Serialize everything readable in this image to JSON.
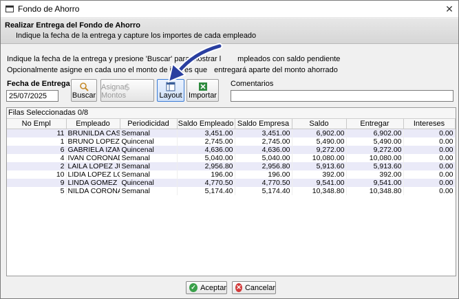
{
  "window": {
    "title": "Fondo de Ahorro",
    "close_glyph": "✕"
  },
  "header": {
    "title": "Realizar Entrega del Fondo de Ahorro",
    "subtitle": "Indique la fecha de la entrega y capture los importes de cada empleado"
  },
  "instructions": {
    "line1_start": "Indique la fecha de la entrega y presione 'Buscar' para mostrar l",
    "line1_end": "mpleados con saldo pendiente",
    "line2_start": "Opcionalmente asigne en cada uno el monto de interés que",
    "line2_end": "entregará aparte del monto ahorrado"
  },
  "form": {
    "date_label": "Fecha de Entrega",
    "date_value": "25/07/2025",
    "comments_label": "Comentarios",
    "comments_value": ""
  },
  "toolbar": {
    "buscar": "Buscar",
    "asignar": "Asignar Montos",
    "layout": "Layout",
    "importar": "Importar"
  },
  "grid": {
    "status": "Filas Seleccionadas  0/8",
    "columns": [
      "No Empl",
      "Empleado",
      "Periodicidad",
      "Saldo Empleado",
      "Saldo Empresa",
      "Saldo",
      "Entregar",
      "Intereses"
    ],
    "rows": [
      [
        "11",
        "BRUNILDA CAST...",
        "Semanal",
        "3,451.00",
        "3,451.00",
        "6,902.00",
        "6,902.00",
        "0.00"
      ],
      [
        "1",
        "BRUNO LOPEZ L...",
        "Quincenal",
        "2,745.00",
        "2,745.00",
        "5,490.00",
        "5,490.00",
        "0.00"
      ],
      [
        "6",
        "GABRIELA IZAM...",
        "Quincenal",
        "4,636.00",
        "4,636.00",
        "9,272.00",
        "9,272.00",
        "0.00"
      ],
      [
        "4",
        "IVAN CORONAD...",
        "Semanal",
        "5,040.00",
        "5,040.00",
        "10,080.00",
        "10,080.00",
        "0.00"
      ],
      [
        "2",
        "LAILA LOPEZ JU...",
        "Semanal",
        "2,956.80",
        "2,956.80",
        "5,913.60",
        "5,913.60",
        "0.00"
      ],
      [
        "10",
        "LIDIA LOPEZ LO...",
        "Semanal",
        "196.00",
        "196.00",
        "392.00",
        "392.00",
        "0.00"
      ],
      [
        "9",
        "LINDA GOMEZ ...",
        "Quincenal",
        "4,770.50",
        "4,770.50",
        "9,541.00",
        "9,541.00",
        "0.00"
      ],
      [
        "5",
        "NILDA CORONA...",
        "Semanal",
        "5,174.40",
        "5,174.40",
        "10,348.80",
        "10,348.80",
        "0.00"
      ]
    ]
  },
  "buttons": {
    "accept": "Aceptar",
    "cancel": "Cancelar",
    "accept_glyph": "✓",
    "cancel_glyph": "✕"
  },
  "colors": {
    "row_alt": "#eaeaf8",
    "accent": "#3a7bd5",
    "accept_green": "#3aa04a",
    "cancel_red": "#d23b3b"
  }
}
